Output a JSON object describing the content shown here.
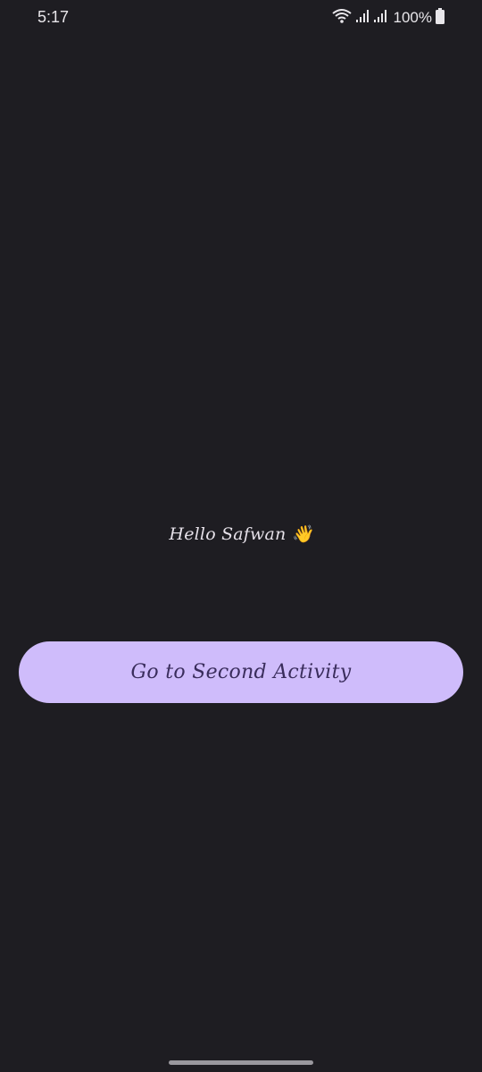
{
  "status_bar": {
    "time": "5:17",
    "battery_text": "100%",
    "icons": [
      "wifi-icon",
      "signal-icon",
      "signal-icon",
      "battery-icon"
    ]
  },
  "main": {
    "greeting": "Hello Safwan 👋",
    "button_label": "Go to Second Activity"
  },
  "colors": {
    "background": "#1e1d22",
    "button": "#cfbcfb",
    "button_text": "#3a2d5c",
    "text": "#e6e1e9"
  }
}
